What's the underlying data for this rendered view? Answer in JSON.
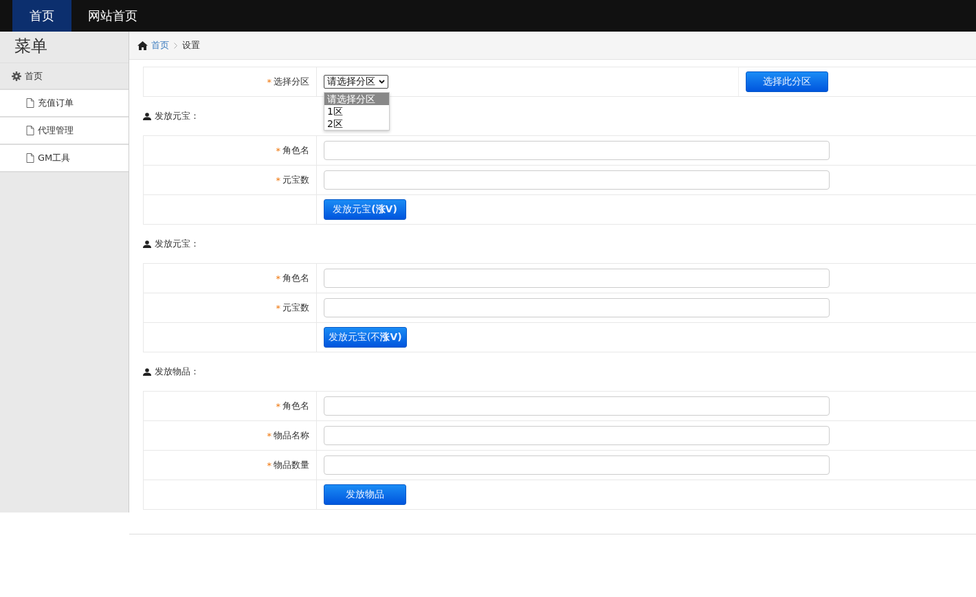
{
  "top_nav": [
    {
      "label": "首页",
      "selected": true
    },
    {
      "label": "网站首页",
      "selected": false
    }
  ],
  "sidebar": {
    "title": "菜单",
    "section": {
      "label": "首页",
      "expanded": true,
      "children": [
        {
          "label": "充值订单"
        },
        {
          "label": "代理管理"
        },
        {
          "label": "GM工具"
        }
      ]
    }
  },
  "breadcrumb": [
    "首页",
    "设置"
  ],
  "zone_form": {
    "marker": "*",
    "label": "选择分区",
    "select": {
      "value": "请选择分区",
      "expanded": true,
      "options": [
        {
          "label": "请选择分区",
          "selected": true
        },
        {
          "label": "1区",
          "selected": false
        },
        {
          "label": "2区",
          "selected": false
        }
      ]
    },
    "button": "选择此分区"
  },
  "sections": [
    {
      "title": "发放元宝：",
      "fields": [
        {
          "marker": "*",
          "label": "角色名"
        },
        {
          "marker": "*",
          "label": "元宝数"
        }
      ],
      "button": "发放元宝**(涨V)**"
    },
    {
      "title": "发放元宝：",
      "fields": [
        {
          "marker": "*",
          "label": "角色名"
        },
        {
          "marker": "*",
          "label": "元宝数"
        }
      ],
      "button": "发放元宝(不**涨V)**"
    },
    {
      "title": "发放物品：",
      "fields": [
        {
          "marker": "*",
          "label": "角色名"
        },
        {
          "marker": "*",
          "label": "物品名称"
        },
        {
          "marker": "*",
          "label": "物品数量"
        }
      ],
      "button": "发放物品"
    }
  ]
}
